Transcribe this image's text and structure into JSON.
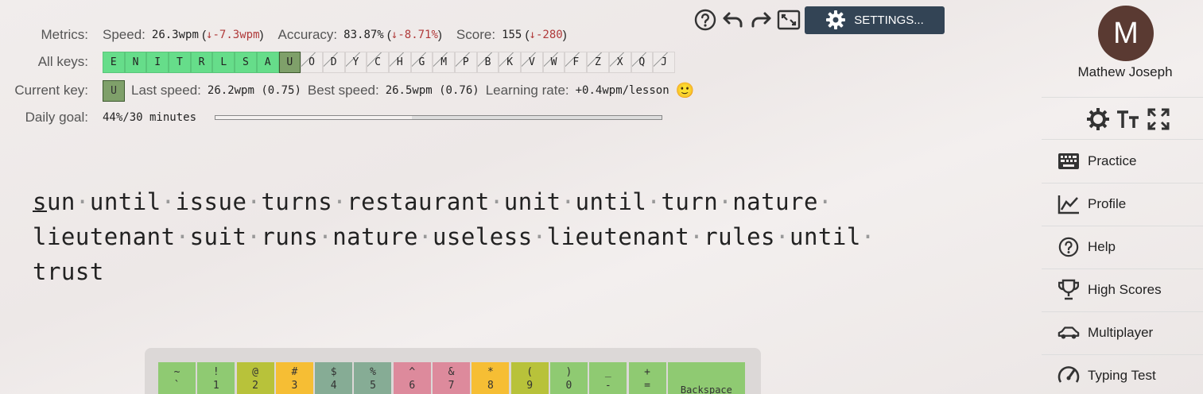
{
  "toolbar": {
    "settings_label": "SETTINGS...",
    "icons": [
      "help-icon",
      "undo-icon",
      "redo-icon",
      "fullscreen-icon",
      "gear-icon"
    ]
  },
  "metrics": {
    "label": "Metrics:",
    "speed_label": "Speed:",
    "speed_value": "26.3wpm",
    "speed_delta": "↓-7.3wpm",
    "accuracy_label": "Accuracy:",
    "accuracy_value": "83.87%",
    "accuracy_delta": "↓-8.71%",
    "score_label": "Score:",
    "score_value": "155",
    "score_delta": "↓-280"
  },
  "all_keys": {
    "label": "All keys:",
    "keys": [
      {
        "k": "E",
        "state": "learned"
      },
      {
        "k": "N",
        "state": "learned"
      },
      {
        "k": "I",
        "state": "learned"
      },
      {
        "k": "T",
        "state": "learned"
      },
      {
        "k": "R",
        "state": "learned"
      },
      {
        "k": "L",
        "state": "learned"
      },
      {
        "k": "S",
        "state": "learned"
      },
      {
        "k": "A",
        "state": "learned"
      },
      {
        "k": "U",
        "state": "current"
      },
      {
        "k": "O",
        "state": "pending"
      },
      {
        "k": "D",
        "state": "pending"
      },
      {
        "k": "Y",
        "state": "pending"
      },
      {
        "k": "C",
        "state": "pending"
      },
      {
        "k": "H",
        "state": "pending"
      },
      {
        "k": "G",
        "state": "pending"
      },
      {
        "k": "M",
        "state": "pending"
      },
      {
        "k": "P",
        "state": "pending"
      },
      {
        "k": "B",
        "state": "pending"
      },
      {
        "k": "K",
        "state": "pending"
      },
      {
        "k": "V",
        "state": "pending"
      },
      {
        "k": "W",
        "state": "pending"
      },
      {
        "k": "F",
        "state": "pending"
      },
      {
        "k": "Z",
        "state": "pending"
      },
      {
        "k": "X",
        "state": "pending"
      },
      {
        "k": "Q",
        "state": "pending"
      },
      {
        "k": "J",
        "state": "pending"
      }
    ]
  },
  "current_key": {
    "label": "Current key:",
    "key": "U",
    "last_speed_label": "Last speed:",
    "last_speed_value": "26.2wpm (0.75)",
    "best_speed_label": "Best speed:",
    "best_speed_value": "26.5wpm (0.76)",
    "learning_rate_label": "Learning rate:",
    "learning_rate_value": "+0.4wpm/lesson",
    "emoji": "🙂"
  },
  "daily_goal": {
    "label": "Daily goal:",
    "value": "44%/30 minutes",
    "progress": 0.44
  },
  "lesson_text": {
    "lines": [
      [
        "sun",
        "until",
        "issue",
        "turns",
        "restaurant",
        "unit",
        "until",
        "turn",
        "nature"
      ],
      [
        "lieutenant",
        "suit",
        "runs",
        "nature",
        "useless",
        "lieutenant",
        "rules",
        "until"
      ],
      [
        "trust"
      ]
    ]
  },
  "keyboard": {
    "keys": [
      {
        "top": "~",
        "bottom": "`",
        "color": "#8fca72"
      },
      {
        "top": "!",
        "bottom": "1",
        "color": "#8fca72"
      },
      {
        "top": "@",
        "bottom": "2",
        "color": "#b8c23a"
      },
      {
        "top": "#",
        "bottom": "3",
        "color": "#f6be34"
      },
      {
        "top": "$",
        "bottom": "4",
        "color": "#86ac95"
      },
      {
        "top": "%",
        "bottom": "5",
        "color": "#86ac95"
      },
      {
        "top": "^",
        "bottom": "6",
        "color": "#dd8a9c"
      },
      {
        "top": "&",
        "bottom": "7",
        "color": "#dd8a9c"
      },
      {
        "top": "*",
        "bottom": "8",
        "color": "#f6be34"
      },
      {
        "top": "(",
        "bottom": "9",
        "color": "#b8c23a"
      },
      {
        "top": ")",
        "bottom": "0",
        "color": "#8fca72"
      },
      {
        "top": "_",
        "bottom": "-",
        "color": "#8fca72"
      },
      {
        "top": "+",
        "bottom": "=",
        "color": "#8fca72"
      }
    ],
    "backspace_label": "Backspace",
    "backspace_color": "#8fca72"
  },
  "user": {
    "initial": "M",
    "name": "Mathew Joseph",
    "avatar_color": "#5a3a32"
  },
  "nav": [
    {
      "label": "Practice",
      "icon": "keyboard-icon"
    },
    {
      "label": "Profile",
      "icon": "chart-icon"
    },
    {
      "label": "Help",
      "icon": "help-icon"
    },
    {
      "label": "High Scores",
      "icon": "trophy-icon"
    },
    {
      "label": "Multiplayer",
      "icon": "car-icon"
    },
    {
      "label": "Typing Test",
      "icon": "speedometer-icon"
    }
  ],
  "view_tools": [
    "theme-icon",
    "font-size-icon",
    "zoom-icon"
  ]
}
